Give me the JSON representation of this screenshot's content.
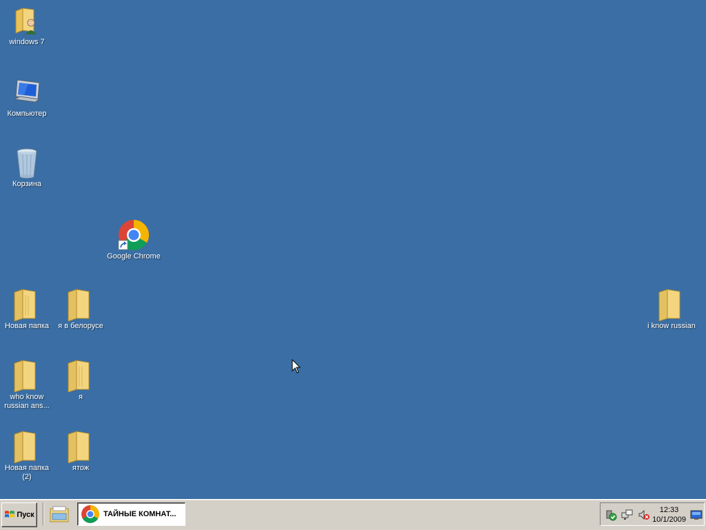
{
  "colors": {
    "desktop_background": "#3a6ea5",
    "folder_yellow": "#f3d57f",
    "taskbar": "#d4d0c8"
  },
  "desktop": {
    "icons": [
      {
        "label": "windows 7",
        "icon": "user-folder-icon"
      },
      {
        "label": "Компьютер",
        "icon": "computer-icon"
      },
      {
        "label": "Корзина",
        "icon": "recycle-bin-icon"
      },
      {
        "label": "Google Chrome",
        "icon": "chrome-shortcut-icon"
      },
      {
        "label": "Новая папка",
        "icon": "folder-icon"
      },
      {
        "label": "я в белорусе",
        "icon": "folder-icon"
      },
      {
        "label": "i know russian",
        "icon": "folder-icon"
      },
      {
        "label": "who know russian ans...",
        "icon": "folder-icon"
      },
      {
        "label": "я",
        "icon": "folder-icon"
      },
      {
        "label": "Новая папка (2)",
        "icon": "folder-icon"
      },
      {
        "label": "ятож",
        "icon": "folder-icon"
      }
    ]
  },
  "taskbar": {
    "start_label": "Пуск",
    "quick_launch_icon": "explorer-icon",
    "tasks": [
      {
        "label": "ТАЙНЫЕ КОМНАТ...",
        "icon": "chrome-icon"
      }
    ],
    "tray": {
      "icons": [
        "safely-remove-icon",
        "network-icon",
        "volume-muted-icon",
        "show-desktop-icon"
      ],
      "time": "12:33",
      "date": "10/1/2009"
    }
  }
}
